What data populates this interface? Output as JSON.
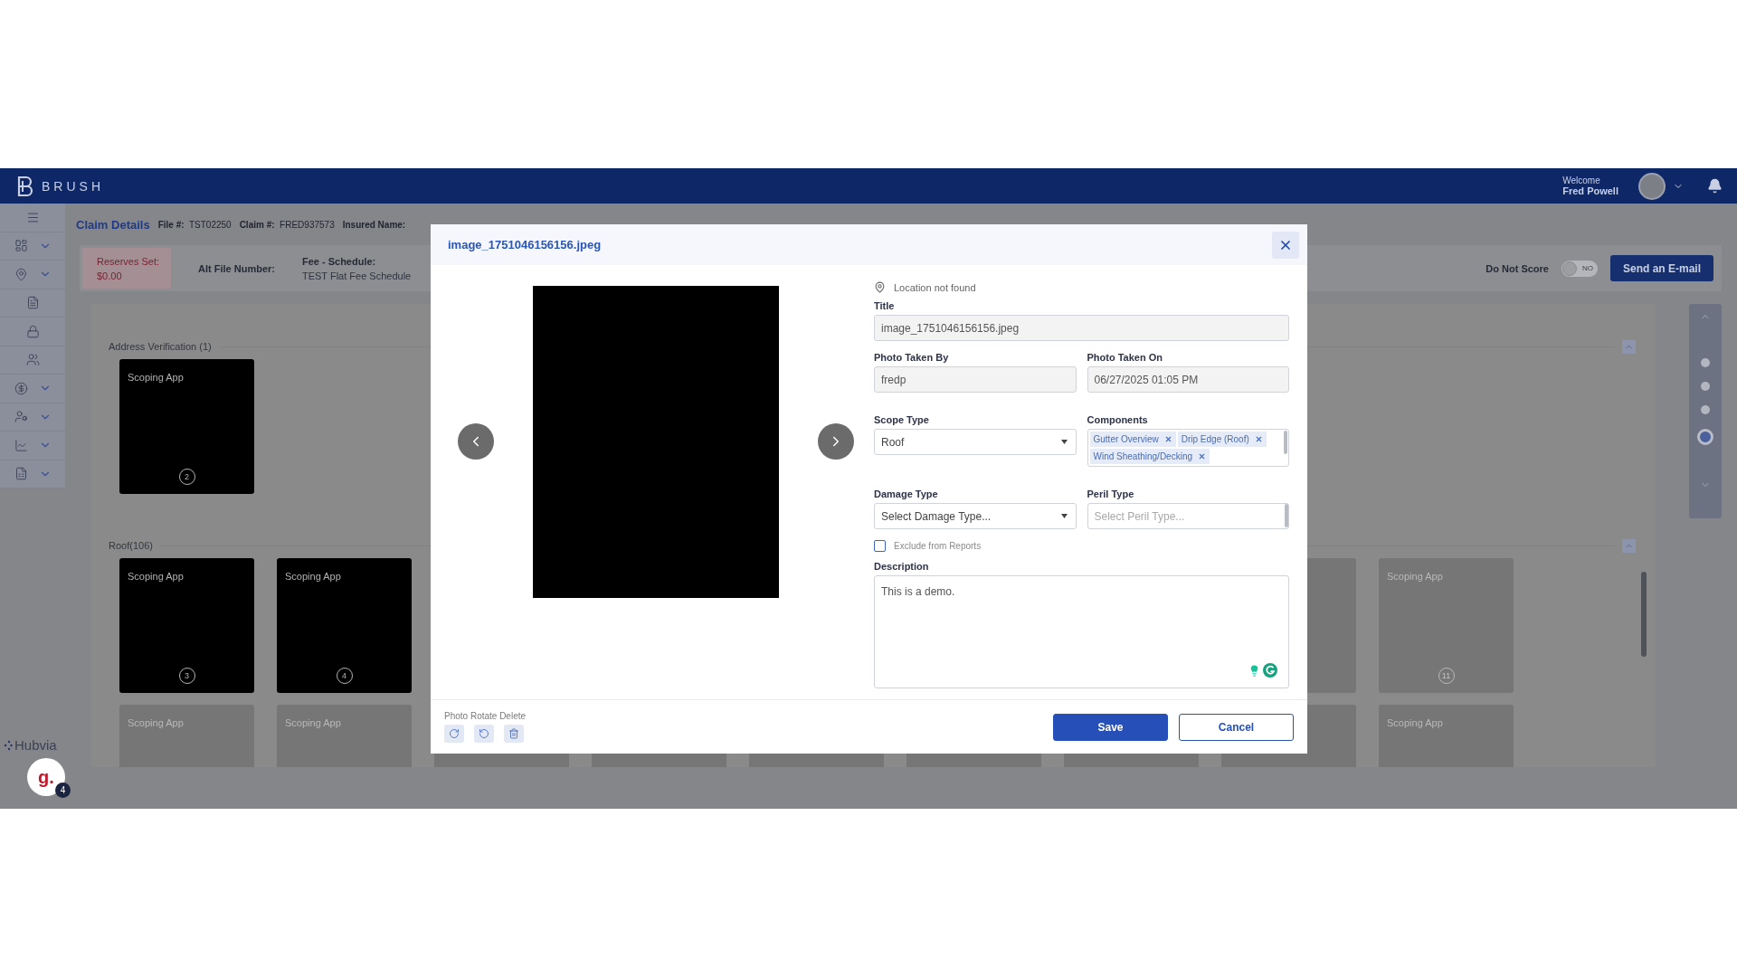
{
  "header": {
    "logo": "BRUSH",
    "welcome": "Welcome",
    "user": "Fred Powell"
  },
  "claim_bar": {
    "title": "Claim Details",
    "fields": [
      {
        "label": "File #:",
        "value": "TST02250"
      },
      {
        "label": "Claim #:",
        "value": "FRED937573"
      },
      {
        "label": "Insured Name:"
      }
    ]
  },
  "summary": {
    "reserves": {
      "label": "Reserves Set:",
      "value": "$0.00"
    },
    "alt_file": {
      "label": "Alt File Number:"
    },
    "fee": {
      "label": "Fee - Schedule:",
      "value": "TEST Flat Fee Schedule"
    },
    "do_not_score": {
      "label": "Do Not Score",
      "toggle_text": "NO",
      "on": false
    },
    "email_button": "Send an E-mail"
  },
  "sections": [
    {
      "title": "Address Verification (1)",
      "expanded": true,
      "tiles": [
        {
          "label": "Scoping App",
          "number": "2"
        }
      ]
    },
    {
      "title": "Roof(106)",
      "expanded": true,
      "tiles": [
        {
          "label": "Scoping App",
          "number": "3"
        },
        {
          "label": "Scoping App",
          "number": "4"
        },
        {
          "kind": "blank"
        },
        {
          "kind": "faded",
          "label": "Scoping App",
          "number": "11"
        },
        {
          "kind": "faded",
          "label": "Scoping App"
        },
        {
          "kind": "faded",
          "label": "Scoping App"
        },
        {
          "kind": "blank"
        },
        {
          "kind": "blank"
        },
        {
          "kind": "blank"
        },
        {
          "kind": "blank"
        },
        {
          "kind": "blank"
        },
        {
          "kind": "blank"
        },
        {
          "kind": "faded",
          "label": "Scoping App"
        }
      ]
    }
  ],
  "right_nav": {
    "dots": [
      {
        "selected": false
      },
      {
        "selected": false
      },
      {
        "selected": false
      },
      {
        "selected": true
      }
    ]
  },
  "bottom": {
    "brand": "Hubvia",
    "chat_logo": "g.",
    "chat_count": "4"
  },
  "modal": {
    "title": "image_1751046156156.jpeg",
    "location": "Location not found",
    "title_field": {
      "label": "Title",
      "value": "image_1751046156156.jpeg"
    },
    "photo_taken_by": {
      "label": "Photo Taken By",
      "value": "fredp"
    },
    "photo_taken_on": {
      "label": "Photo Taken On",
      "value": "06/27/2025 01:05 PM"
    },
    "scope_type": {
      "label": "Scope Type",
      "value": "Roof"
    },
    "components": {
      "label": "Components",
      "chips": [
        "Gutter Overview",
        "Drip Edge (Roof)",
        "Wind Sheathing/Decking"
      ]
    },
    "damage_type": {
      "label": "Damage Type",
      "value": "Select Damage Type..."
    },
    "peril_type": {
      "label": "Peril Type",
      "placeholder": "Select Peril Type..."
    },
    "exclude": {
      "label": "Exclude from Reports",
      "checked": false
    },
    "description": {
      "label": "Description",
      "value": "This is a demo."
    },
    "footer_label": "Photo Rotate Delete",
    "buttons": [
      {
        "label": "Save",
        "kind": "primary"
      },
      {
        "label": "Cancel",
        "kind": "secondary"
      }
    ]
  }
}
